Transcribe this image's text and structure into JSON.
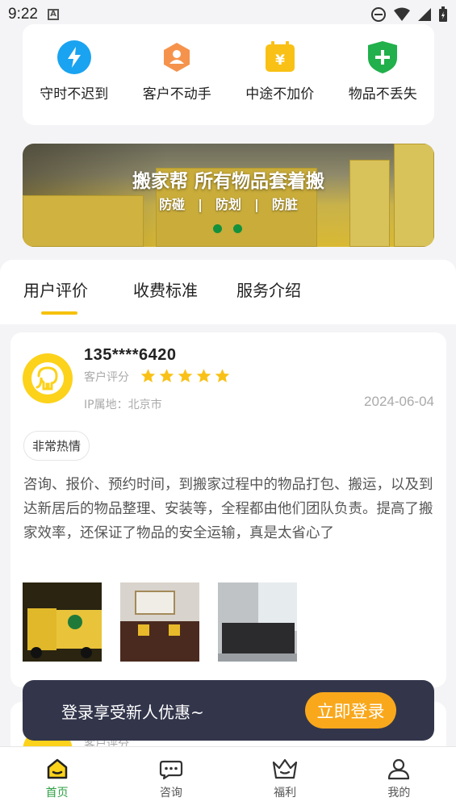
{
  "status_bar": {
    "time": "9:22",
    "a_icon": "A"
  },
  "features": [
    {
      "icon": "lightning-icon",
      "color": "#1aa3f0",
      "label": "守时不迟到"
    },
    {
      "icon": "person-icon",
      "color": "#f5934d",
      "label": "客户不动手"
    },
    {
      "icon": "price-tag-icon",
      "color": "#f9c116",
      "label": "中途不加价"
    },
    {
      "icon": "shield-plus-icon",
      "color": "#21b04b",
      "label": "物品不丢失"
    }
  ],
  "banner": {
    "title": "搬家帮 所有物品套着搬",
    "subtitles": [
      "防碰",
      "防划",
      "防脏"
    ]
  },
  "tabs": [
    {
      "label": "用户评价",
      "active": true
    },
    {
      "label": "收费标准",
      "active": false
    },
    {
      "label": "服务介绍",
      "active": false
    }
  ],
  "review": {
    "phone": "135****6420",
    "rating_label": "客户评分",
    "stars": 5,
    "ip": "IP属地：北京市",
    "date": "2024-06-04",
    "tag": "非常热情",
    "content": "咨询、报价、预约时间，到搬家过程中的物品打包、搬运，以及到达新居后的物品整理、安装等，全程都由他们团队负责。提高了搬家效率，还保证了物品的安全运输，真是太省心了"
  },
  "review2": {
    "rating_label": "客户评分"
  },
  "login_prompt": {
    "text": "登录享受新人优惠~",
    "button": "立即登录"
  },
  "bottom_nav": [
    {
      "icon": "home-icon",
      "label": "首页",
      "active": true
    },
    {
      "icon": "chat-icon",
      "label": "咨询",
      "active": false
    },
    {
      "icon": "crown-icon",
      "label": "福利",
      "active": false
    },
    {
      "icon": "user-icon",
      "label": "我的",
      "active": false
    }
  ],
  "colors": {
    "accent_yellow": "#f5c20a",
    "active_green": "#2ea043",
    "login_bg": "#33364b",
    "login_button": "#f9a81c"
  }
}
